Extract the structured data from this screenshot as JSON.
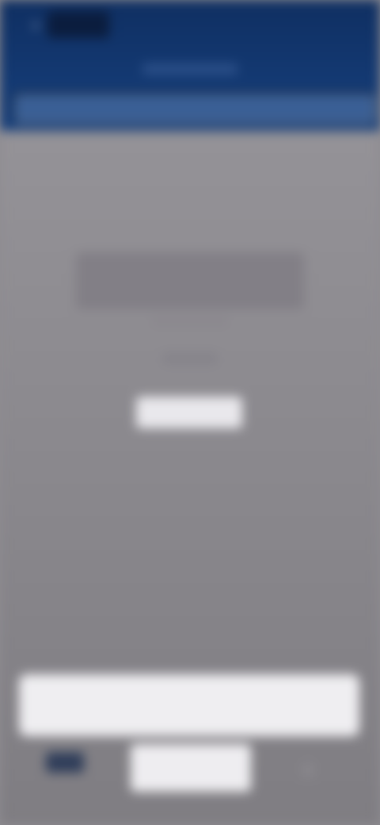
{
  "header": {
    "back_icon": "arrow-left-icon",
    "logo_icon": "brand-logo",
    "action_label": "",
    "subtitle": "",
    "search_placeholder": ""
  },
  "main": {
    "empty_title": "",
    "empty_subtitle": "",
    "empty_detail": "",
    "button_label": ""
  },
  "footer": {
    "banner_text": "",
    "left_icon": "home-icon",
    "center_tab_label": "",
    "right_icon": "menu-icon"
  },
  "colors": {
    "header_bg": "#163f7c",
    "overlay_bg": "#8e8c91",
    "surface": "#efeef1"
  }
}
